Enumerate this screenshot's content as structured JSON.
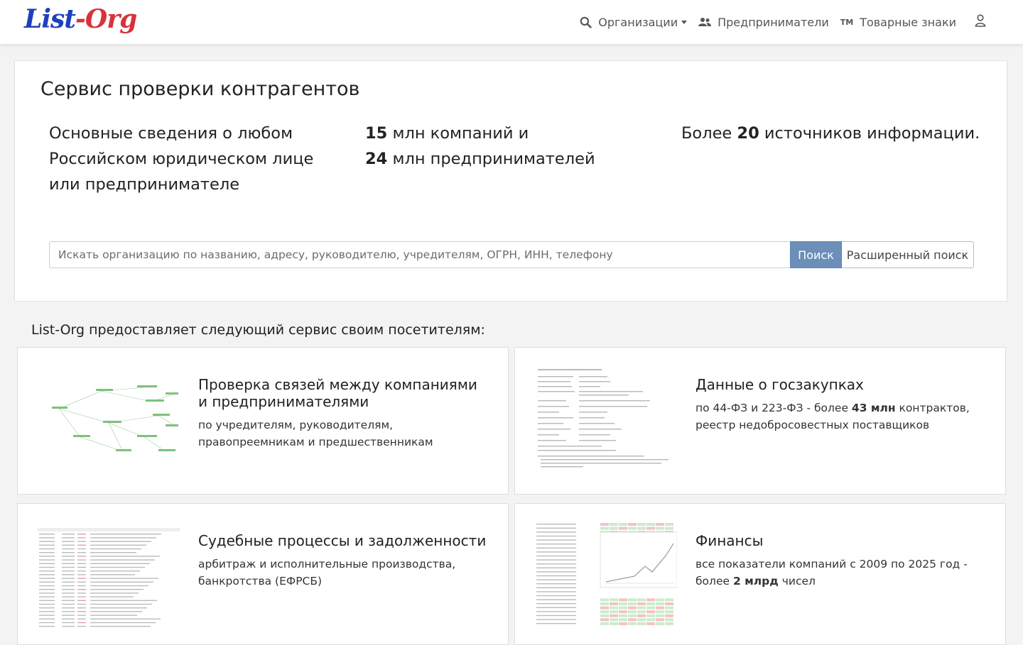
{
  "logo": {
    "part1": "List",
    "dash": "-",
    "part2": "Org"
  },
  "nav": {
    "organizations": "Организации",
    "entrepreneurs": "Предприниматели",
    "trademarks_badge": "TM",
    "trademarks": "Товарные знаки"
  },
  "hero": {
    "title": "Сервис проверки контрагентов",
    "feature1": "Основные сведения о любом Российском юридическом лице или предпринимателе",
    "feature2": {
      "n1": "15",
      "t1": " млн компаний и",
      "n2": "24",
      "t2": " млн предпринимателей"
    },
    "feature3": {
      "pre": "Более ",
      "n": "20",
      "post": " источников информации."
    }
  },
  "search": {
    "placeholder": "Искать организацию по названию, адресу, руководителю, учредителям, ОГРН, ИНН, телефону",
    "button": "Поиск",
    "advanced": "Расширенный поиск"
  },
  "services": {
    "title": "List-Org предоставляет следующий сервис своим посетителям:",
    "items": [
      {
        "title": "Проверка связей между компаниями и предпринимателями",
        "desc": "по учредителям, руководителям, правопреемникам и предшественникам"
      },
      {
        "title": "Данные о госзакупках",
        "desc_pre": "по 44-ФЗ и 223-ФЗ - более ",
        "desc_bold": "43 млн",
        "desc_post": " контрактов, реестр недобросовестных поставщиков"
      },
      {
        "title": "Судебные процессы и задолженности",
        "desc": "арбитраж и исполнительные производства, банкротства (ЕФРСБ)"
      },
      {
        "title": "Финансы",
        "desc_pre": "все показатели компаний с 2009 по 2025 год - более ",
        "desc_bold": "2 млрд",
        "desc_post": " чисел"
      }
    ]
  },
  "colors": {
    "logo_blue": "#1d3fbf",
    "logo_red": "#d9313a",
    "search_button": "#6b8fb8"
  }
}
